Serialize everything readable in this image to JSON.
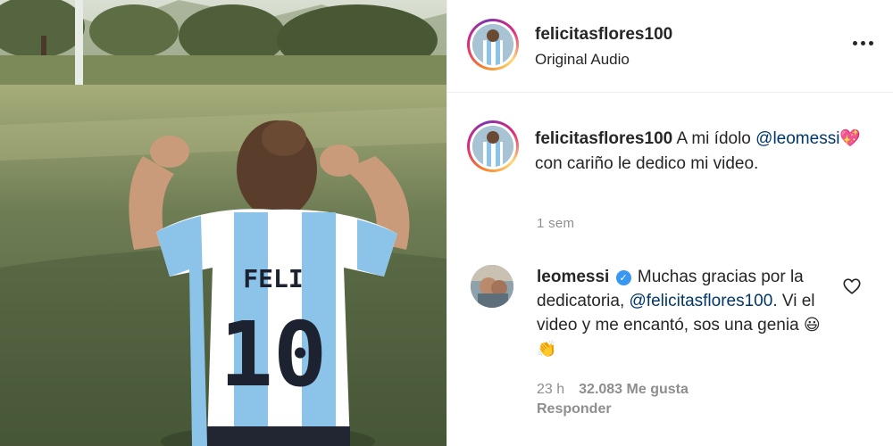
{
  "post": {
    "username": "felicitasflores100",
    "audio": "Original Audio",
    "more_icon": "more-horizontal-icon"
  },
  "caption": {
    "username": "felicitasflores100",
    "text_before": "A mi ídolo",
    "mention": "@leomessi",
    "emoji": "💖",
    "text_after": "con cariño le dedico mi video.",
    "age": "1 sem"
  },
  "comment": {
    "username": "leomessi",
    "verified_icon": "verified-badge-icon",
    "text_1": "Muchas gracias por la dedicatoria,",
    "mention": "@felicitasflores100",
    "text_2": ". Vi el video y me encantó, sos una genia",
    "emoji_1": "😃",
    "emoji_2": "👏",
    "time": "23 h",
    "likes": "32.083 Me gusta",
    "reply": "Responder",
    "like_icon": "heart-outline-icon"
  },
  "media": {
    "jersey_name": "FELI",
    "jersey_number": "10"
  },
  "colors": {
    "mention": "#00376b",
    "muted": "#8e8e8e",
    "verified": "#3897f0",
    "jersey_blue": "#8cc3e8"
  }
}
